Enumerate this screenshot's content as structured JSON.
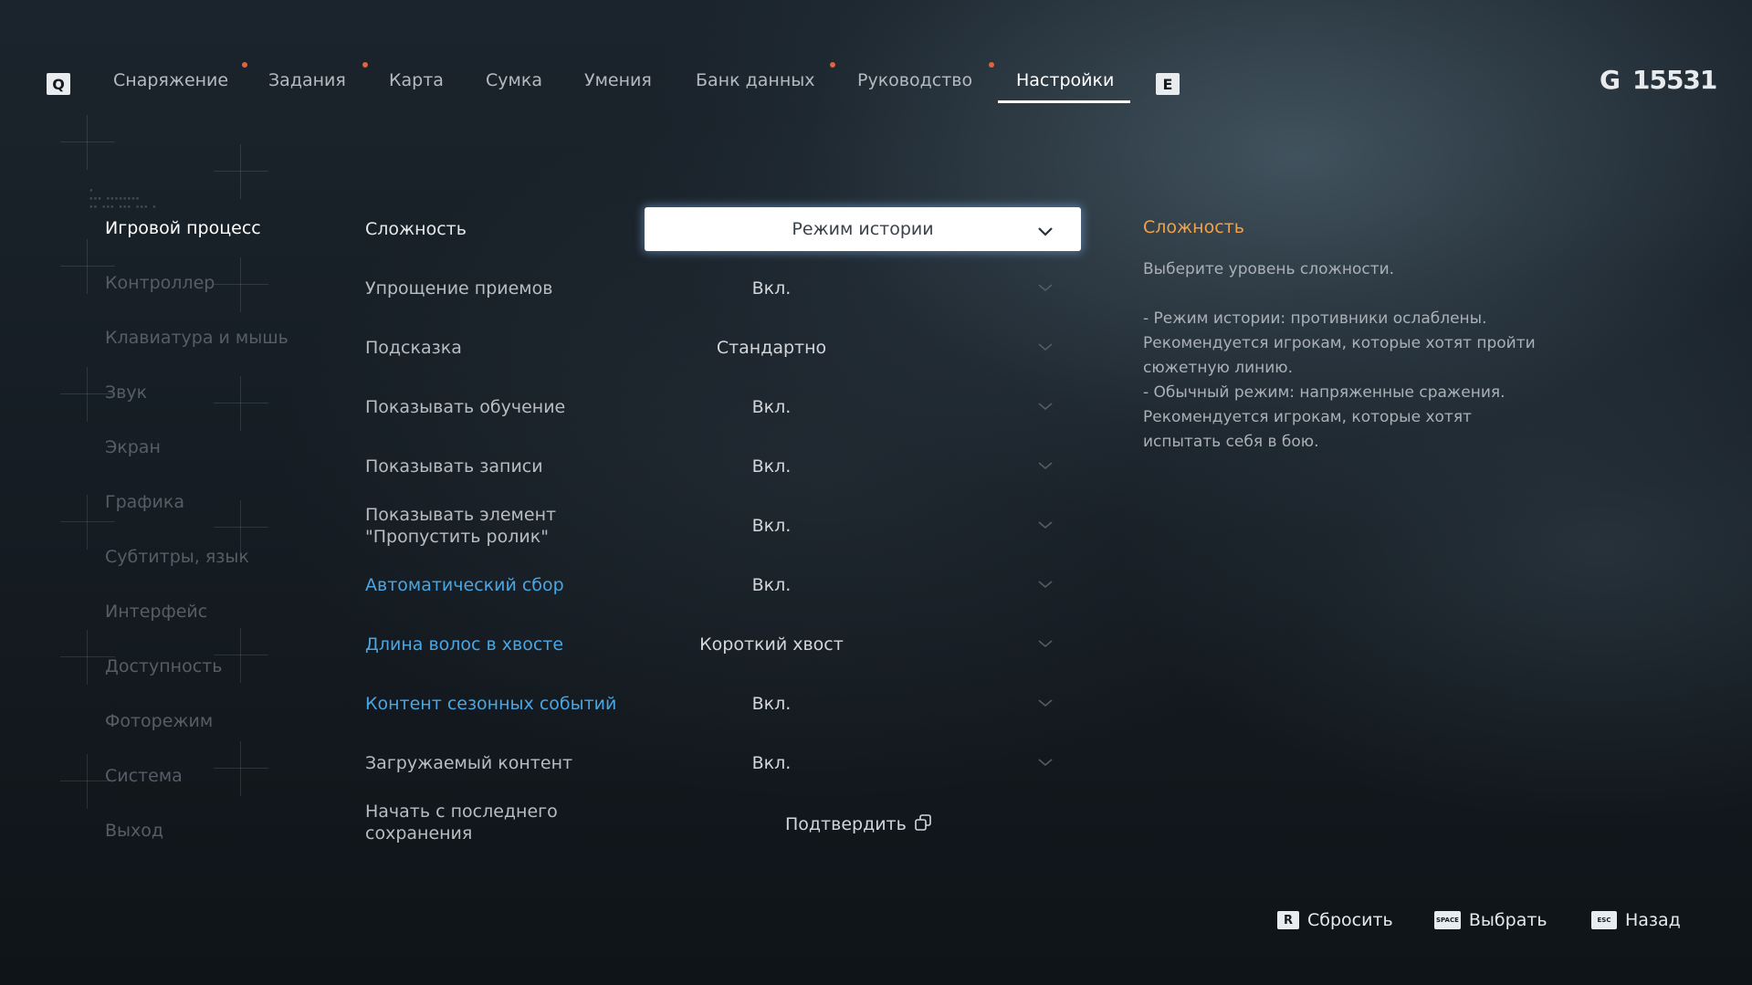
{
  "top_nav": {
    "prev_key": "Q",
    "next_key": "E",
    "tabs": [
      {
        "label": "Снаряжение",
        "notification": true
      },
      {
        "label": "Задания",
        "notification": true
      },
      {
        "label": "Карта",
        "notification": false
      },
      {
        "label": "Сумка",
        "notification": false
      },
      {
        "label": "Умения",
        "notification": false
      },
      {
        "label": "Банк данных",
        "notification": true
      },
      {
        "label": "Руководство",
        "notification": true
      },
      {
        "label": "Настройки",
        "notification": false,
        "active": true
      }
    ],
    "currency": {
      "icon": "G",
      "amount": "15531"
    }
  },
  "sidebar": {
    "items": [
      {
        "label": "Игровой процесс",
        "active": true
      },
      {
        "label": "Контроллер"
      },
      {
        "label": "Клавиатура и мышь"
      },
      {
        "label": "Звук"
      },
      {
        "label": "Экран"
      },
      {
        "label": "Графика"
      },
      {
        "label": "Субтитры, язык"
      },
      {
        "label": "Интерфейс"
      },
      {
        "label": "Доступность"
      },
      {
        "label": "Фоторежим"
      },
      {
        "label": "Система"
      },
      {
        "label": "Выход"
      }
    ]
  },
  "settings": {
    "rows": [
      {
        "label": "Сложность",
        "value": "Режим истории",
        "selected": true
      },
      {
        "label": "Упрощение приемов",
        "value": "Вкл."
      },
      {
        "label": "Подсказка",
        "value": "Стандартно"
      },
      {
        "label": "Показывать обучение",
        "value": "Вкл."
      },
      {
        "label": "Показывать записи",
        "value": "Вкл."
      },
      {
        "label": "Показывать элемент \"Пропустить ролик\"",
        "value": "Вкл."
      },
      {
        "label": "Автоматический сбор",
        "value": "Вкл.",
        "highlight": true
      },
      {
        "label": "Длина волос в хвосте",
        "value": "Короткий хвост",
        "highlight": true
      },
      {
        "label": "Контент сезонных событий",
        "value": "Вкл.",
        "highlight": true
      },
      {
        "label": "Загружаемый контент",
        "value": "Вкл."
      },
      {
        "label": "Начать с последнего сохранения",
        "value": "Подтвердить",
        "action": true
      }
    ]
  },
  "description": {
    "title": "Сложность",
    "intro": "Выберите уровень сложности.",
    "story_mode": "- Режим истории: противники ослаблены. Рекомендуется игрокам, которые хотят пройти сюжетную линию.",
    "normal_mode": "- Обычный режим: напряженные сражения. Рекомендуется игрокам, которые хотят испытать себя в бою."
  },
  "hints": [
    {
      "key": "R",
      "label": "Сбросить"
    },
    {
      "key": "SPACE",
      "label": "Выбрать"
    },
    {
      "key": "ESC",
      "label": "Назад"
    }
  ],
  "colors": {
    "accent_orange": "#f0a24a",
    "highlight_blue": "#4aa6e3",
    "notification_dot": "#e2623c"
  }
}
